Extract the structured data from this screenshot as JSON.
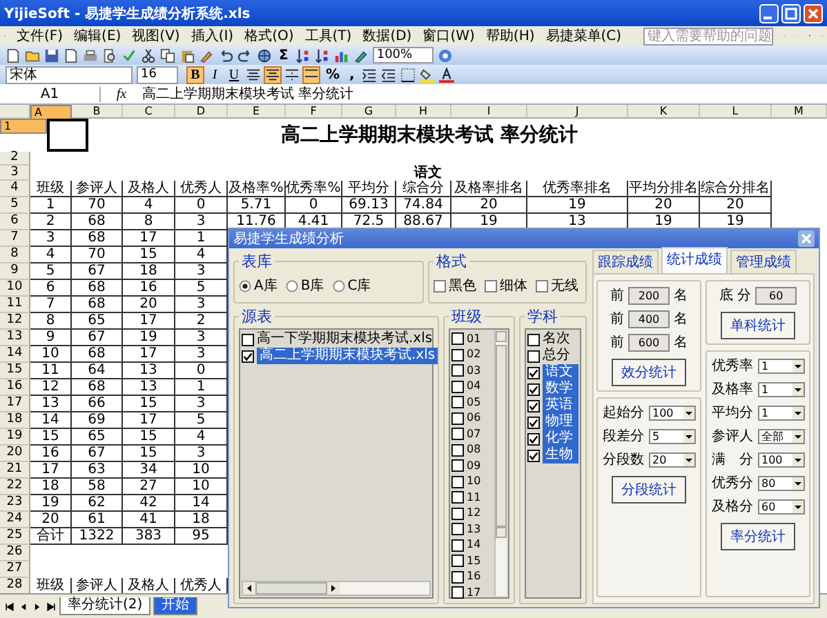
{
  "window": {
    "title": "YijieSoft - 易捷学生成绩分析系统.xls"
  },
  "menu": {
    "items": [
      "文件(F)",
      "编辑(E)",
      "视图(V)",
      "插入(I)",
      "格式(O)",
      "工具(T)",
      "数据(D)",
      "窗口(W)",
      "帮助(H)",
      "易捷菜单(C)"
    ],
    "help_placeholder": "键入需要帮助的问题"
  },
  "toolbar": {
    "sum": "Σ",
    "zoom": "100%"
  },
  "format_bar": {
    "font": "宋体",
    "size": "16",
    "styles": [
      {
        "label": "B",
        "on": true
      },
      {
        "label": "I",
        "on": false
      },
      {
        "label": "U",
        "on": false
      }
    ],
    "align": [
      {
        "kind": "left",
        "on": false
      },
      {
        "kind": "center",
        "on": true
      },
      {
        "kind": "right",
        "on": false
      },
      {
        "kind": "merge",
        "on": true
      }
    ],
    "percent": "%",
    "comma": ","
  },
  "formula_bar": {
    "name_box": "A1",
    "fx": "fx",
    "formula": "高二上学期期末模块考试 率分统计"
  },
  "sheet": {
    "columns": [
      {
        "label": "A",
        "selected": true
      },
      {
        "label": "B",
        "selected": false
      },
      {
        "label": "C",
        "selected": false
      },
      {
        "label": "D",
        "selected": false
      },
      {
        "label": "E",
        "selected": false
      },
      {
        "label": "F",
        "selected": false
      },
      {
        "label": "G",
        "selected": false
      },
      {
        "label": "H",
        "selected": false
      },
      {
        "label": "I",
        "selected": false
      },
      {
        "label": "J",
        "selected": false
      },
      {
        "label": "K",
        "selected": false
      },
      {
        "label": "L",
        "selected": false
      },
      {
        "label": "M",
        "selected": false
      }
    ],
    "rows": [
      {
        "number": "1",
        "selected": true,
        "kind": "title",
        "text": "高二上学期期末模块考试 率分统计"
      },
      {
        "number": "2",
        "selected": false,
        "kind": "blank"
      },
      {
        "number": "3",
        "selected": false,
        "kind": "section",
        "text": "语文"
      },
      {
        "number": "4",
        "selected": false,
        "kind": "cells",
        "cells": [
          "班级",
          "参评人",
          "及格人",
          "优秀人",
          "及格率%",
          "优秀率%",
          "平均分",
          "综合分",
          "及格率排名",
          "优秀率排名",
          "平均分排名",
          "综合分排名"
        ]
      },
      {
        "number": "5",
        "selected": false,
        "kind": "cells",
        "cells": [
          "1",
          "70",
          "4",
          "0",
          "5.71",
          "0",
          "69.13",
          "74.84",
          "20",
          "19",
          "20",
          "20"
        ]
      },
      {
        "number": "6",
        "selected": false,
        "kind": "cells",
        "cells": [
          "2",
          "68",
          "8",
          "3",
          "11.76",
          "4.41",
          "72.5",
          "88.67",
          "19",
          "13",
          "19",
          "19"
        ]
      },
      {
        "number": "7",
        "selected": false,
        "kind": "cells",
        "cells": [
          "3",
          "68",
          "17",
          "1"
        ]
      },
      {
        "number": "8",
        "selected": false,
        "kind": "cells",
        "cells": [
          "4",
          "70",
          "15",
          "4"
        ]
      },
      {
        "number": "9",
        "selected": false,
        "kind": "cells",
        "cells": [
          "5",
          "67",
          "18",
          "3"
        ]
      },
      {
        "number": "10",
        "selected": false,
        "kind": "cells",
        "cells": [
          "6",
          "68",
          "16",
          "5"
        ]
      },
      {
        "number": "11",
        "selected": false,
        "kind": "cells",
        "cells": [
          "7",
          "68",
          "20",
          "3"
        ]
      },
      {
        "number": "12",
        "selected": false,
        "kind": "cells",
        "cells": [
          "8",
          "65",
          "17",
          "2"
        ]
      },
      {
        "number": "13",
        "selected": false,
        "kind": "cells",
        "cells": [
          "9",
          "67",
          "19",
          "3"
        ]
      },
      {
        "number": "14",
        "selected": false,
        "kind": "cells",
        "cells": [
          "10",
          "68",
          "17",
          "3"
        ]
      },
      {
        "number": "15",
        "selected": false,
        "kind": "cells",
        "cells": [
          "11",
          "64",
          "13",
          "0"
        ]
      },
      {
        "number": "16",
        "selected": false,
        "kind": "cells",
        "cells": [
          "12",
          "68",
          "13",
          "1"
        ]
      },
      {
        "number": "17",
        "selected": false,
        "kind": "cells",
        "cells": [
          "13",
          "66",
          "15",
          "3"
        ]
      },
      {
        "number": "18",
        "selected": false,
        "kind": "cells",
        "cells": [
          "14",
          "69",
          "17",
          "5"
        ]
      },
      {
        "number": "19",
        "selected": false,
        "kind": "cells",
        "cells": [
          "15",
          "65",
          "15",
          "4"
        ]
      },
      {
        "number": "20",
        "selected": false,
        "kind": "cells",
        "cells": [
          "16",
          "67",
          "15",
          "3"
        ]
      },
      {
        "number": "21",
        "selected": false,
        "kind": "cells",
        "cells": [
          "17",
          "63",
          "34",
          "10"
        ]
      },
      {
        "number": "22",
        "selected": false,
        "kind": "cells",
        "cells": [
          "18",
          "58",
          "27",
          "10"
        ]
      },
      {
        "number": "23",
        "selected": false,
        "kind": "cells",
        "cells": [
          "19",
          "62",
          "42",
          "14"
        ]
      },
      {
        "number": "24",
        "selected": false,
        "kind": "cells",
        "cells": [
          "20",
          "61",
          "41",
          "18"
        ]
      },
      {
        "number": "25",
        "selected": false,
        "kind": "cells",
        "cells": [
          "合计",
          "1322",
          "383",
          "95"
        ]
      },
      {
        "number": "26",
        "selected": false,
        "kind": "blank"
      },
      {
        "number": "27",
        "selected": false,
        "kind": "blank"
      },
      {
        "number": "28",
        "selected": false,
        "kind": "cells",
        "cells": [
          "班级",
          "参评人",
          "及格人",
          "优秀人"
        ]
      }
    ]
  },
  "sheet_tabs": [
    {
      "label": "率分统计(2)",
      "selected": false
    },
    {
      "label": "开始",
      "selected": true
    }
  ],
  "dialog": {
    "title": "易捷学生成绩分析",
    "library": {
      "label": "表库",
      "options": [
        {
          "label": "A库",
          "selected": true
        },
        {
          "label": "B库",
          "selected": false
        },
        {
          "label": "C库",
          "selected": false
        }
      ]
    },
    "format": {
      "label": "格式",
      "options": [
        {
          "label": "黑色",
          "checked": false
        },
        {
          "label": "细体",
          "checked": false
        },
        {
          "label": "无线",
          "checked": false
        }
      ]
    },
    "sources": {
      "label": "源表",
      "items": [
        {
          "label": "高一下学期期末模块考试.xls",
          "checked": false,
          "selected": false
        },
        {
          "label": "高二上学期期末模块考试.xls",
          "checked": true,
          "selected": true
        }
      ]
    },
    "classes": {
      "label": "班级",
      "items": [
        {
          "label": "01",
          "checked": false
        },
        {
          "label": "02",
          "checked": false
        },
        {
          "label": "03",
          "checked": false
        },
        {
          "label": "04",
          "checked": false
        },
        {
          "label": "05",
          "checked": false
        },
        {
          "label": "06",
          "checked": false
        },
        {
          "label": "07",
          "checked": false
        },
        {
          "label": "08",
          "checked": false
        },
        {
          "label": "09",
          "checked": false
        },
        {
          "label": "10",
          "checked": false
        },
        {
          "label": "11",
          "checked": false
        },
        {
          "label": "12",
          "checked": false
        },
        {
          "label": "13",
          "checked": false
        },
        {
          "label": "14",
          "checked": false
        },
        {
          "label": "15",
          "checked": false
        },
        {
          "label": "16",
          "checked": false
        },
        {
          "label": "17",
          "checked": false
        }
      ]
    },
    "subjects": {
      "label": "学科",
      "items": [
        {
          "label": "名次",
          "checked": false,
          "selected": false
        },
        {
          "label": "总分",
          "checked": false,
          "selected": false
        },
        {
          "label": "语文",
          "checked": true,
          "selected": true
        },
        {
          "label": "数学",
          "checked": true,
          "selected": true
        },
        {
          "label": "英语",
          "checked": true,
          "selected": true
        },
        {
          "label": "物理",
          "checked": true,
          "selected": true
        },
        {
          "label": "化学",
          "checked": true,
          "selected": true
        },
        {
          "label": "生物",
          "checked": true,
          "selected": true
        }
      ]
    },
    "tabs": [
      {
        "label": "跟踪成绩",
        "selected": false
      },
      {
        "label": "统计成绩",
        "selected": true
      },
      {
        "label": "管理成绩",
        "selected": false
      }
    ],
    "top_n": {
      "rows": [
        {
          "before": "前",
          "value": "200",
          "after": "名"
        },
        {
          "before": "前",
          "value": "400",
          "after": "名"
        },
        {
          "before": "前",
          "value": "600",
          "after": "名"
        }
      ],
      "button": "效分统计"
    },
    "base": {
      "label": "底 分",
      "value": "60",
      "button": "单科统计"
    },
    "segments": {
      "rows": [
        {
          "label": "起始分",
          "value": "100"
        },
        {
          "label": "段差分",
          "value": "5"
        },
        {
          "label": "分段数",
          "value": "20"
        }
      ],
      "button": "分段统计"
    },
    "rates": {
      "rows": [
        {
          "label": "优秀率",
          "value": "1"
        },
        {
          "label": "及格率",
          "value": "1"
        },
        {
          "label": "平均分",
          "value": "1"
        },
        {
          "label": "参评人",
          "value": "全部"
        },
        {
          "label": "满　分",
          "value": "100"
        },
        {
          "label": "优秀分",
          "value": "80"
        },
        {
          "label": "及格分",
          "value": "60"
        }
      ],
      "button": "率分统计"
    }
  }
}
